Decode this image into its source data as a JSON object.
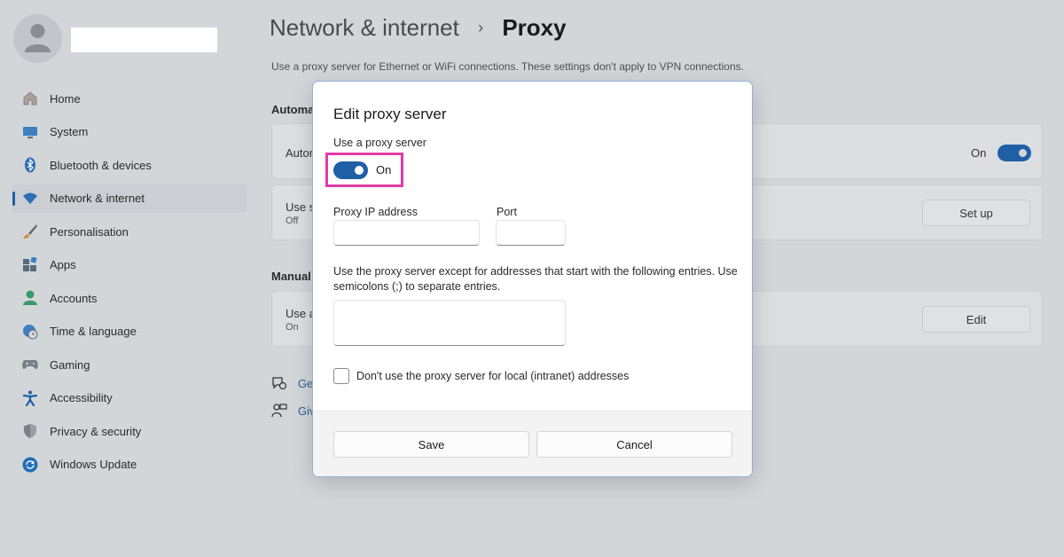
{
  "sidebar": {
    "items": [
      {
        "label": "Home",
        "icon": "home-icon"
      },
      {
        "label": "System",
        "icon": "monitor-icon"
      },
      {
        "label": "Bluetooth & devices",
        "icon": "bluetooth-icon"
      },
      {
        "label": "Network & internet",
        "icon": "wifi-icon",
        "active": true
      },
      {
        "label": "Personalisation",
        "icon": "brush-icon"
      },
      {
        "label": "Apps",
        "icon": "apps-icon"
      },
      {
        "label": "Accounts",
        "icon": "person-icon"
      },
      {
        "label": "Time & language",
        "icon": "globe-clock-icon"
      },
      {
        "label": "Gaming",
        "icon": "gamepad-icon"
      },
      {
        "label": "Accessibility",
        "icon": "accessibility-icon"
      },
      {
        "label": "Privacy & security",
        "icon": "shield-icon"
      },
      {
        "label": "Windows Update",
        "icon": "update-icon"
      }
    ]
  },
  "header": {
    "breadcrumb_parent": "Network & internet",
    "breadcrumb_separator": "›",
    "breadcrumb_current": "Proxy",
    "description": "Use a proxy server for Ethernet or WiFi connections. These settings don't apply to VPN connections."
  },
  "background": {
    "auto_section": "Automa",
    "auto_detect_title": "Autom",
    "auto_detect_state": "On",
    "setup_script_title": "Use s",
    "setup_script_sub": "Off",
    "setup_button": "Set up",
    "manual_section": "Manual",
    "manual_title": "Use a",
    "manual_sub": "On",
    "edit_button": "Edit",
    "help_link_1": "Ge",
    "help_link_2": "Giv"
  },
  "dialog": {
    "title": "Edit proxy server",
    "use_proxy_label": "Use a proxy server",
    "toggle_state": "On",
    "ip_label": "Proxy IP address",
    "ip_value": "",
    "port_label": "Port",
    "port_value": "",
    "exceptions_desc": "Use the proxy server except for addresses that start with the following entries. Use semicolons (;) to separate entries.",
    "exceptions_value": "",
    "local_checkbox_label": "Don't use the proxy server for local (intranet) addresses",
    "local_checkbox_checked": false,
    "save_label": "Save",
    "cancel_label": "Cancel"
  },
  "colors": {
    "accent": "#1f5fa6",
    "highlight": "#e23aa8"
  }
}
